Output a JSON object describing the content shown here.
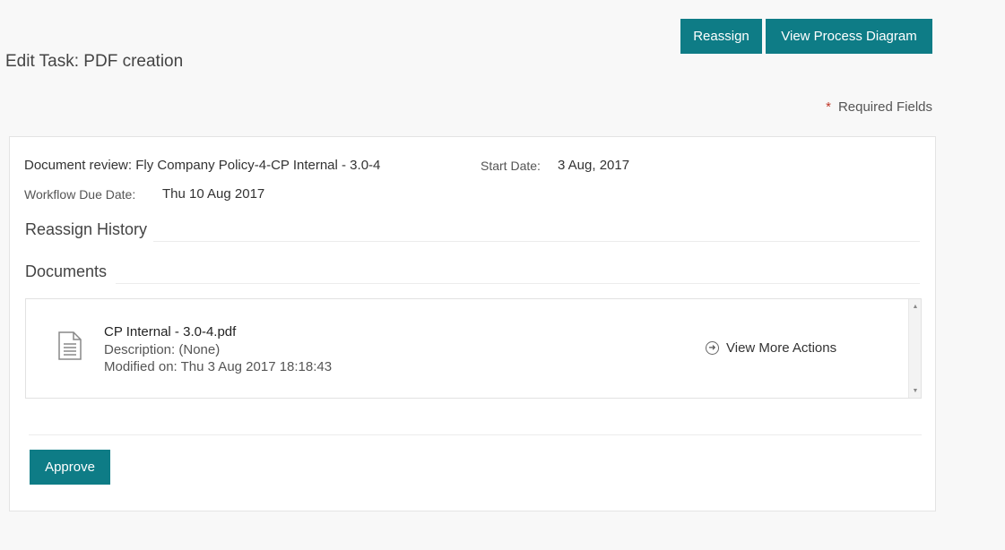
{
  "header": {
    "reassign_label": "Reassign",
    "view_diagram_label": "View Process Diagram",
    "page_title": "Edit Task: PDF creation",
    "required_star": "*",
    "required_label": "Required Fields"
  },
  "task": {
    "message": "Document review: Fly Company Policy-4-CP Internal - 3.0-4",
    "start_date_label": "Start Date:",
    "start_date_value": "3 Aug, 2017",
    "due_date_label": "Workflow Due Date:",
    "due_date_value": "Thu 10 Aug 2017"
  },
  "sections": {
    "reassign_history": "Reassign History",
    "documents": "Documents"
  },
  "documents": [
    {
      "name": "CP Internal - 3.0-4.pdf",
      "description": "Description: (None)",
      "modified": "Modified on: Thu 3 Aug 2017 18:18:43",
      "more_actions_label": "View More Actions",
      "icon": "document-icon"
    }
  ],
  "actions": {
    "approve_label": "Approve"
  },
  "colors": {
    "accent": "#0e7c86",
    "required_star": "#c0392b"
  }
}
